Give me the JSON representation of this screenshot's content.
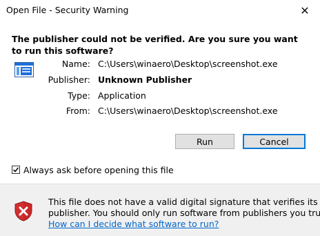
{
  "window": {
    "title": "Open File - Security Warning",
    "close_glyph": "✕"
  },
  "heading": "The publisher could not be verified.  Are you sure you want to run this software?",
  "fields": [
    {
      "label": "Name:",
      "value": "C:\\Users\\winaero\\Desktop\\screenshot.exe",
      "bold": false
    },
    {
      "label": "Publisher:",
      "value": "Unknown Publisher",
      "bold": true
    },
    {
      "label": "Type:",
      "value": "Application",
      "bold": false
    },
    {
      "label": "From:",
      "value": "C:\\Users\\winaero\\Desktop\\screenshot.exe",
      "bold": false
    }
  ],
  "buttons": {
    "run_label": "Run",
    "cancel_label": "Cancel"
  },
  "checkbox": {
    "label": "Always ask before opening this file",
    "checked": true
  },
  "footer": {
    "line1": "This file does not have a valid digital signature that verifies its",
    "line2": "publisher.  You should only run software from publishers you trust.",
    "link_text": "How can I decide what software to run?"
  },
  "icons": {
    "app": "application-window-icon",
    "warning": "shield-warning-icon"
  },
  "colors": {
    "link": "#0066cc",
    "shield_red": "#d32f2f",
    "app_icon_blue": "#1e6fd9",
    "primary_button_border": "#0078d7",
    "footer_bg": "#f0f0f0"
  }
}
